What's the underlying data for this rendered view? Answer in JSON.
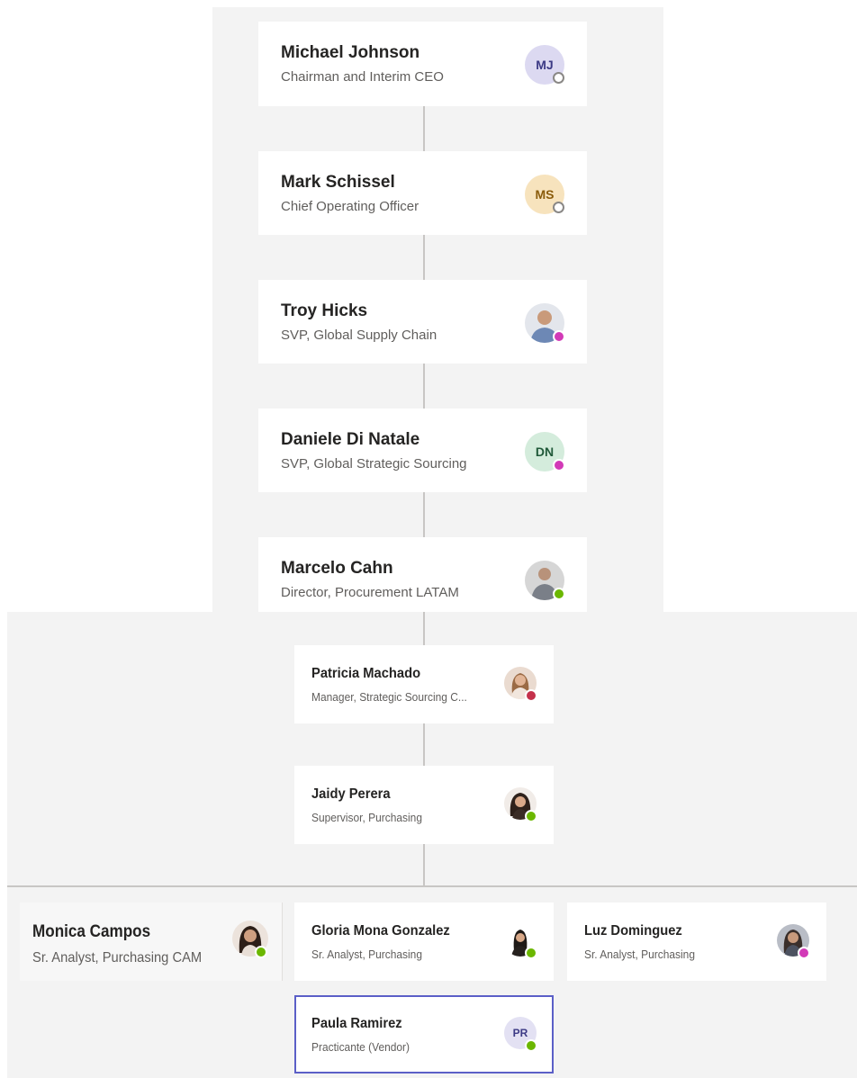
{
  "people": [
    {
      "name": "Michael Johnson",
      "title": "Chairman and Interim CEO",
      "initials": "MJ",
      "avatar_bg": "#dcd9f1",
      "initials_color": "#3c3a85",
      "status": "offline"
    },
    {
      "name": "Mark Schissel",
      "title": "Chief Operating Officer",
      "initials": "MS",
      "avatar_bg": "#f7e3bd",
      "initials_color": "#8a5b0a",
      "status": "offline"
    },
    {
      "name": "Troy Hicks",
      "title": "SVP, Global Supply Chain",
      "initials": "",
      "avatar_bg": "#d7dbe3",
      "status": "away-return"
    },
    {
      "name": "Daniele Di Natale",
      "title": "SVP, Global Strategic Sourcing",
      "initials": "DN",
      "avatar_bg": "#d4ecdc",
      "initials_color": "#215a3a",
      "status": "away-return"
    },
    {
      "name": "Marcelo Cahn",
      "title": "Director, Procurement LATAM",
      "initials": "",
      "avatar_bg": "#cfcfcf",
      "status": "available"
    },
    {
      "name": "Patricia Machado",
      "title": "Manager, Strategic Sourcing C...",
      "initials": "",
      "avatar_bg": "#e6cdbf",
      "status": "busy"
    },
    {
      "name": "Jaidy Perera",
      "title": "Supervisor, Purchasing",
      "initials": "",
      "avatar_bg": "#d8c4b6",
      "status": "available"
    },
    {
      "name": "Monica Campos",
      "title": "Sr. Analyst, Purchasing CAM",
      "initials": "",
      "avatar_bg": "#d6c1b2",
      "status": "available"
    },
    {
      "name": "Gloria Mona Gonzalez",
      "title": "Sr. Analyst, Purchasing",
      "initials": "",
      "avatar_bg": "#e9e6e4",
      "status": "available"
    },
    {
      "name": "Luz Dominguez",
      "title": "Sr. Analyst, Purchasing",
      "initials": "",
      "avatar_bg": "#c9ccd2",
      "status": "away-return"
    },
    {
      "name": "Paula Ramirez",
      "title": "Practicante (Vendor)",
      "initials": "PR",
      "avatar_bg": "#e3e1f3",
      "initials_color": "#3c3a85",
      "status": "available"
    }
  ],
  "colors": {
    "available": "#6bb700",
    "busy": "#c4314b",
    "away-return": "#d23ab7",
    "offline": "#8a8886",
    "selected_border": "#5b5fc7"
  }
}
